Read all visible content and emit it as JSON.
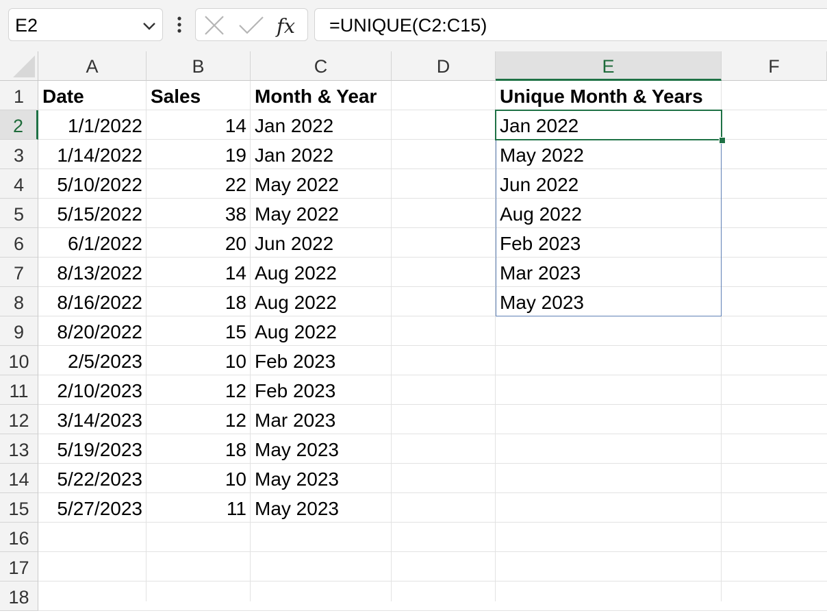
{
  "name_box": {
    "value": "E2"
  },
  "formula_bar": {
    "fx_label": "fx",
    "formula": "=UNIQUE(C2:C15)"
  },
  "icons": {
    "name_box_dropdown": "chevron-down-icon",
    "more": "kebab-icon",
    "cancel": "x-icon",
    "enter": "check-icon"
  },
  "colors": {
    "accent": "#1e7145",
    "spill_border": "#5d7fb5",
    "header_bg": "#f3f3f3"
  },
  "columns": [
    "A",
    "B",
    "C",
    "D",
    "E",
    "F"
  ],
  "selected_column": "E",
  "row_numbers": [
    "1",
    "2",
    "3",
    "4",
    "5",
    "6",
    "7",
    "8",
    "9",
    "10",
    "11",
    "12",
    "13",
    "14",
    "15",
    "16",
    "17",
    "18"
  ],
  "selected_row": "2",
  "header_row": {
    "a": "Date",
    "b": "Sales",
    "c": "Month & Year",
    "e": "Unique Month & Years"
  },
  "data_rows": [
    {
      "date": "1/1/2022",
      "sales": "14",
      "month_year": "Jan 2022"
    },
    {
      "date": "1/14/2022",
      "sales": "19",
      "month_year": "Jan 2022"
    },
    {
      "date": "5/10/2022",
      "sales": "22",
      "month_year": "May 2022"
    },
    {
      "date": "5/15/2022",
      "sales": "38",
      "month_year": "May 2022"
    },
    {
      "date": "6/1/2022",
      "sales": "20",
      "month_year": "Jun 2022"
    },
    {
      "date": "8/13/2022",
      "sales": "14",
      "month_year": "Aug 2022"
    },
    {
      "date": "8/16/2022",
      "sales": "18",
      "month_year": "Aug 2022"
    },
    {
      "date": "8/20/2022",
      "sales": "15",
      "month_year": "Aug 2022"
    },
    {
      "date": "2/5/2023",
      "sales": "10",
      "month_year": "Feb 2023"
    },
    {
      "date": "2/10/2023",
      "sales": "12",
      "month_year": "Feb 2023"
    },
    {
      "date": "3/14/2023",
      "sales": "12",
      "month_year": "Mar 2023"
    },
    {
      "date": "5/19/2023",
      "sales": "18",
      "month_year": "May 2023"
    },
    {
      "date": "5/22/2023",
      "sales": "10",
      "month_year": "May 2023"
    },
    {
      "date": "5/27/2023",
      "sales": "11",
      "month_year": "May 2023"
    }
  ],
  "unique_values": [
    "Jan 2022",
    "May 2022",
    "Jun 2022",
    "Aug 2022",
    "Feb 2023",
    "Mar 2023",
    "May 2023"
  ]
}
